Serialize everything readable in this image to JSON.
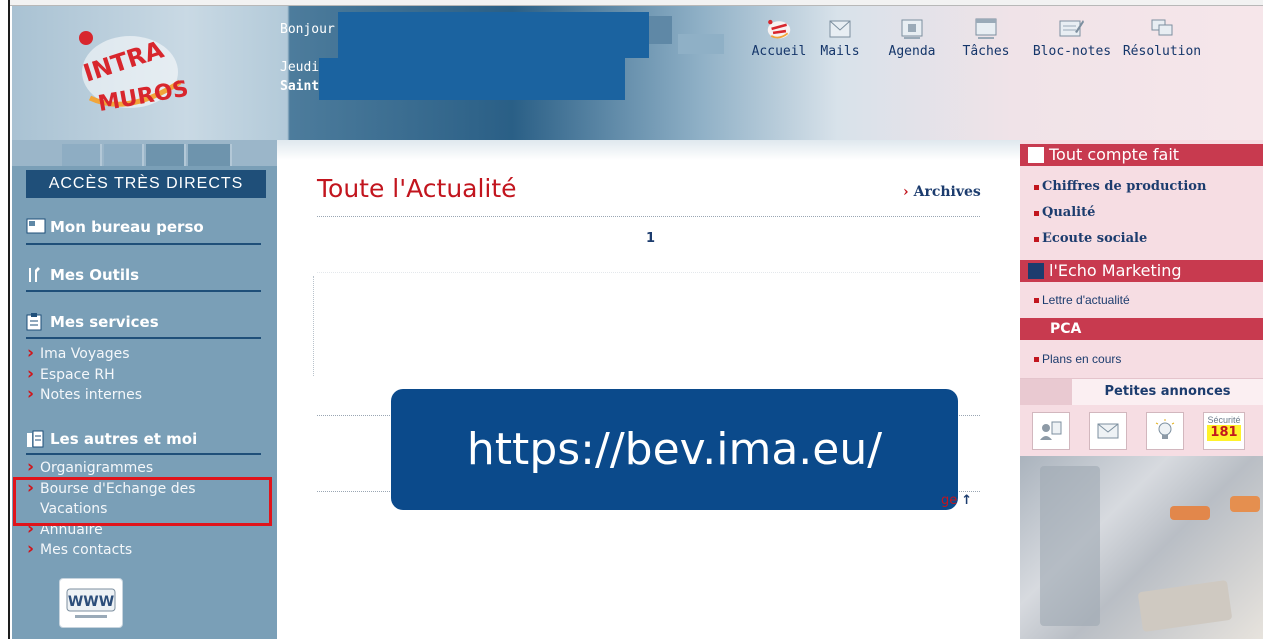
{
  "header": {
    "greeting": "Bonjour",
    "day": "Jeudi",
    "saint": "Saint",
    "nav": [
      {
        "label": "Accueil",
        "icon": "intra-muros-home-icon"
      },
      {
        "label": "Mails",
        "icon": "mail-icon"
      },
      {
        "label": "Agenda",
        "icon": "calendar-icon"
      },
      {
        "label": "Tâches",
        "icon": "tasks-icon"
      },
      {
        "label": "Bloc-notes",
        "icon": "notepad-icon"
      },
      {
        "label": "Résolution",
        "icon": "resolution-icon"
      }
    ]
  },
  "logo": {
    "line1": "INTRA",
    "line2": "MUROS"
  },
  "sidebar": {
    "acces_title": "ACCÈS TRÈS DIRECTS",
    "bureau": "Mon bureau perso",
    "outils": "Mes Outils",
    "services": {
      "title": "Mes services",
      "items": [
        "Ima Voyages",
        "Espace RH",
        "Notes internes"
      ]
    },
    "autres": {
      "title": "Les autres et moi",
      "items": [
        "Organigrammes",
        "Bourse d'Echange des Vacations",
        "Annuaire",
        "Mes contacts"
      ]
    },
    "www_label": "WWW"
  },
  "main": {
    "title": "Toute l'Actualité",
    "archives": "Archives",
    "page_number": "1",
    "url_banner": "https://bev.ima.eu/",
    "haut_fragment": "ge"
  },
  "right": {
    "tout_compte_fait": {
      "title": "Tout compte fait",
      "items": [
        "Chiffres de production",
        "Qualité",
        "Ecoute sociale"
      ]
    },
    "echo": {
      "title": "l'Echo Marketing",
      "items": [
        "Lettre d'actualité"
      ]
    },
    "pca": {
      "title": "PCA",
      "items": [
        "Plans en cours"
      ]
    },
    "annonces": "Petites annonces",
    "securite": {
      "label": "Sécurité",
      "number": "181"
    }
  },
  "colors": {
    "accent_red": "#c2151e",
    "navy": "#1c3c6e",
    "sidebar_blue": "#7a9fb7",
    "banner_blue": "#0b4a8b",
    "highlight_box": "#e0141b"
  }
}
